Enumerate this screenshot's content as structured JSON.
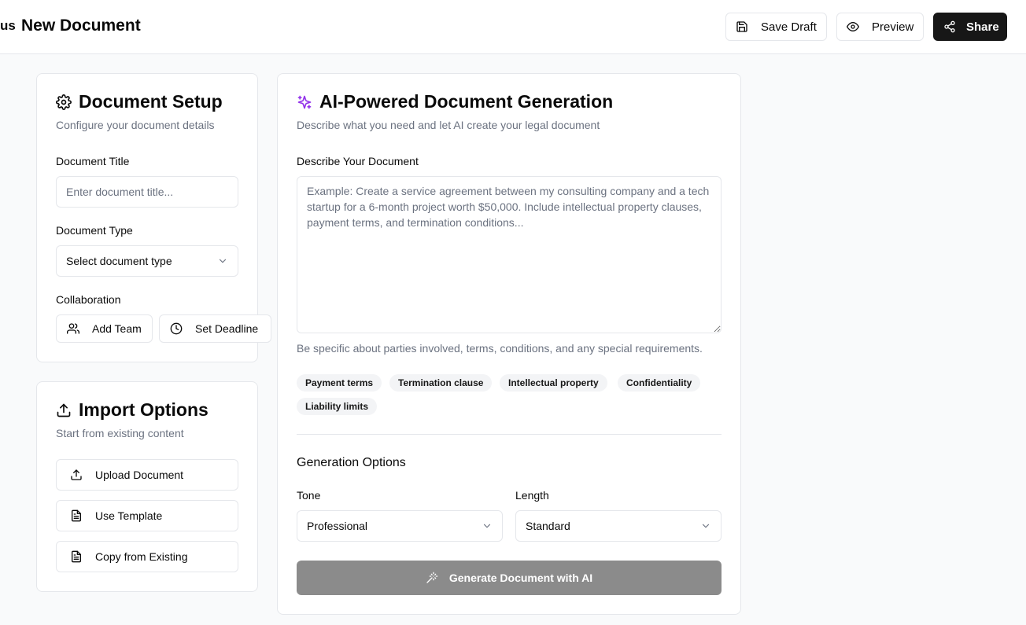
{
  "header": {
    "back_text": "us",
    "title": "New Document",
    "save_draft": "Save Draft",
    "preview": "Preview",
    "share": "Share"
  },
  "setup": {
    "title": "Document Setup",
    "subtitle": "Configure your document details",
    "doc_title_label": "Document Title",
    "doc_title_placeholder": "Enter document title...",
    "doc_type_label": "Document Type",
    "doc_type_value": "Select document type",
    "collab_label": "Collaboration",
    "add_team": "Add Team",
    "set_deadline": "Set Deadline"
  },
  "import": {
    "title": "Import Options",
    "subtitle": "Start from existing content",
    "upload": "Upload Document",
    "template": "Use Template",
    "copy": "Copy from Existing"
  },
  "ai": {
    "title": "AI-Powered Document Generation",
    "subtitle": "Describe what you need and let AI create your legal document",
    "describe_label": "Describe Your Document",
    "describe_placeholder": "Example: Create a service agreement between my consulting company and a tech startup for a 6-month project worth $50,000. Include intellectual property clauses, payment terms, and termination conditions...",
    "hint": "Be specific about parties involved, terms, conditions, and any special requirements.",
    "chips": [
      "Payment terms",
      "Termination clause",
      "Intellectual property",
      "Confidentiality",
      "Liability limits"
    ],
    "options_title": "Generation Options",
    "tone_label": "Tone",
    "tone_value": "Professional",
    "length_label": "Length",
    "length_value": "Standard",
    "generate": "Generate Document with AI"
  },
  "colors": {
    "accent_sparkle": "#9333ea",
    "share_bg": "#171717",
    "generate_bg": "#8b8b8b"
  }
}
